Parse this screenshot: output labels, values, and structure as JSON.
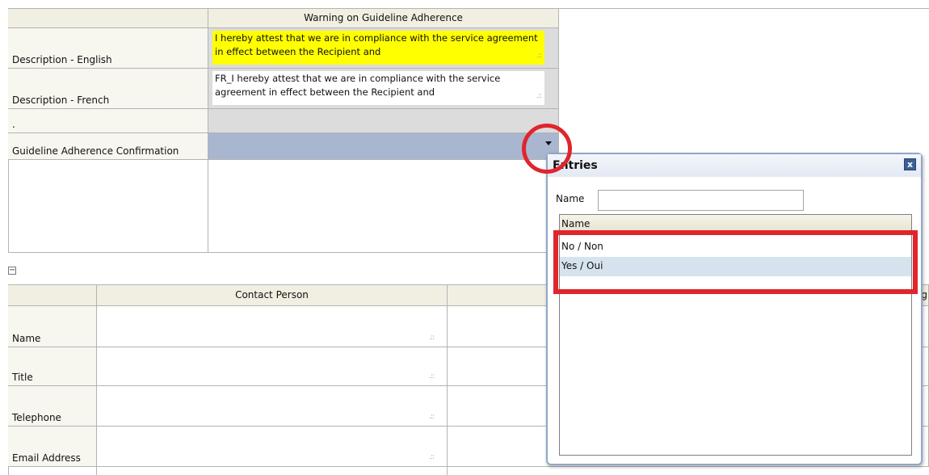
{
  "section": {
    "header": "Warning on Guideline Adherence",
    "rows": {
      "desc_en_label": "Description - English",
      "desc_en_value": "I hereby attest that we are in compliance with the service agreement in effect between the Recipient and",
      "desc_fr_label": "Description - French",
      "desc_fr_value": "FR_I hereby attest that we are in compliance with the service agreement in effect between the Recipient and",
      "dot_label": ".",
      "adherence_label": "Guideline Adherence Confirmation"
    }
  },
  "contact": {
    "header": "Contact Person",
    "rows": [
      "Name",
      "Title",
      "Telephone",
      "Email Address"
    ],
    "partial_header_char": "g"
  },
  "popup": {
    "title": "Entries",
    "close": "x",
    "name_label": "Name",
    "name_value": "",
    "column_header": "Name",
    "options": [
      "No / Non",
      "Yes / Oui"
    ],
    "hovered_index": 1
  },
  "colors": {
    "highlight_yellow": "#ffff00",
    "select_bar": "#a9b6cf",
    "annotation_red": "#e0252d",
    "hover_row": "#d6e3ee"
  },
  "icons": {
    "collapse": "minus-square-icon",
    "dropdown": "dropdown-arrow-icon",
    "close": "close-x-icon"
  }
}
